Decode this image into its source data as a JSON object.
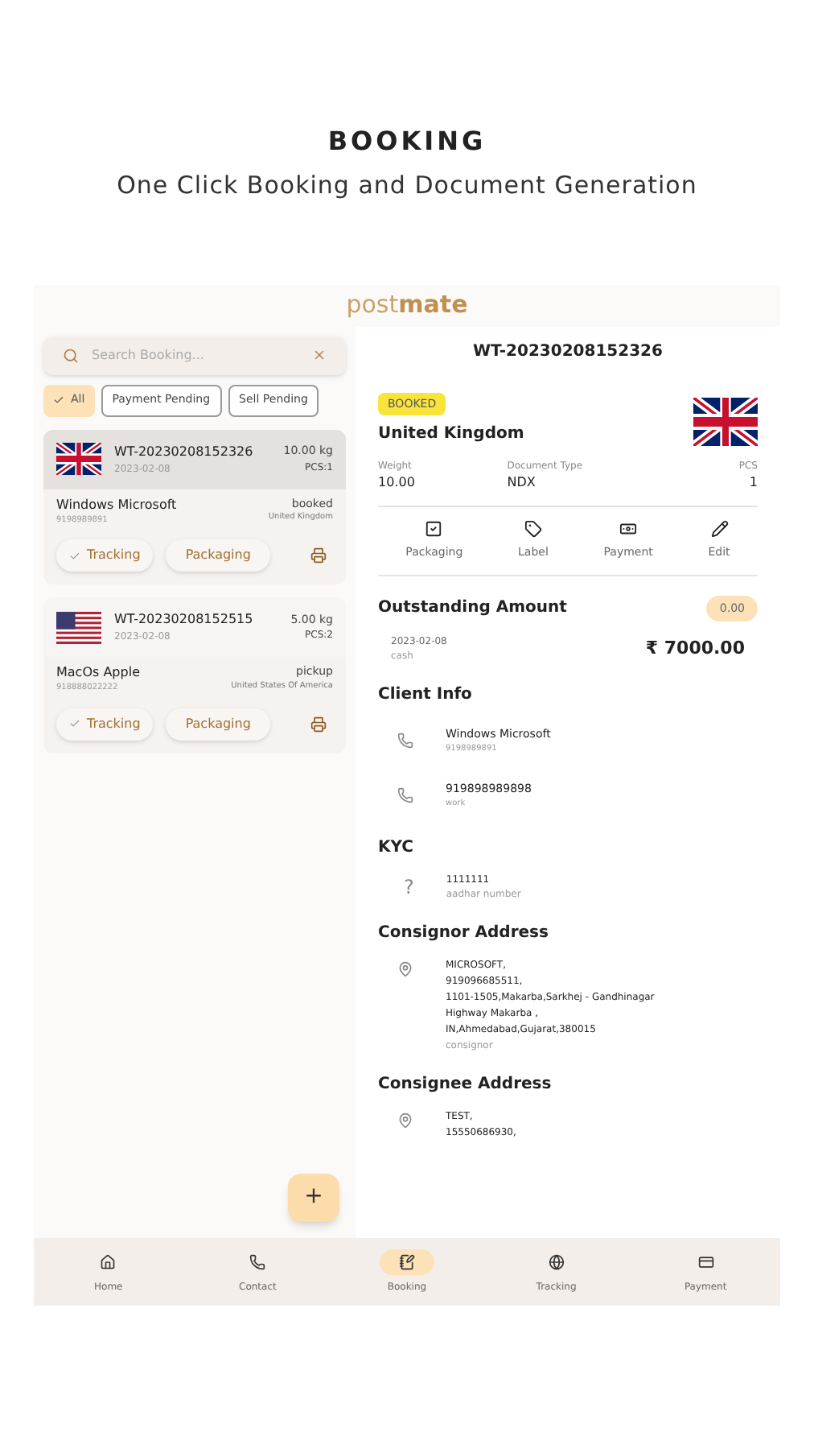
{
  "promo": {
    "title": "BOOKING",
    "subtitle": "One Click Booking and Document Generation"
  },
  "logo": {
    "light": "post",
    "bold": "mate"
  },
  "search": {
    "placeholder": "Search Booking..."
  },
  "filters": [
    {
      "label": "All",
      "selected": true
    },
    {
      "label": "Payment Pending",
      "selected": false
    },
    {
      "label": "Sell Pending",
      "selected": false
    }
  ],
  "bookings": [
    {
      "id": "WT-20230208152326",
      "date": "2023-02-08",
      "weight": "10.00 kg",
      "pcs": "PCS:1",
      "name": "Windows Microsoft",
      "phone": "9198989891",
      "status": "booked",
      "country": "United Kingdom",
      "flag": {
        "kind": "gb"
      },
      "selected": true,
      "tracking": "Tracking",
      "packaging": "Packaging"
    },
    {
      "id": "WT-20230208152515",
      "date": "2023-02-08",
      "weight": "5.00 kg",
      "pcs": "PCS:2",
      "name": "MacOs Apple",
      "phone": "918888022222",
      "status": "pickup",
      "country": "United States Of America",
      "flag": {
        "kind": "us"
      },
      "selected": false,
      "tracking": "Tracking",
      "packaging": "Packaging"
    }
  ],
  "fab": "+",
  "detail": {
    "id": "WT-20230208152326",
    "status": "BOOKED",
    "country": "United Kingdom",
    "flag": {
      "kind": "gb"
    },
    "fields": [
      {
        "label": "Weight",
        "value": "10.00"
      },
      {
        "label": "Document Type",
        "value": "NDX"
      },
      {
        "label": "PCS",
        "value": "1"
      }
    ],
    "actions": [
      {
        "kind": "packaging",
        "label": "Packaging"
      },
      {
        "kind": "label",
        "label": "Label"
      },
      {
        "kind": "payment",
        "label": "Payment"
      },
      {
        "kind": "edit",
        "label": "Edit"
      }
    ],
    "outstanding": {
      "title": "Outstanding Amount",
      "badge": "0.00",
      "date": "2023-02-08",
      "method": "cash",
      "amount": "₹ 7000.00"
    },
    "client_info": {
      "title": "Client Info",
      "entries": [
        {
          "primary": "Windows Microsoft",
          "secondary": "9198989891"
        },
        {
          "primary": "919898989898",
          "secondary": "work"
        }
      ]
    },
    "kyc": {
      "title": "KYC",
      "icon": "?",
      "primary": "1111111",
      "secondary": "aadhar number"
    },
    "consignor": {
      "title": "Consignor Address",
      "lines": [
        "MICROSOFT,",
        "919096685511,",
        "1101-1505,Makarba,Sarkhej - Gandhinagar",
        "Highway Makarba ,",
        "IN,Ahmedabad,Gujarat,380015"
      ],
      "note": "consignor"
    },
    "consignee": {
      "title": "Consignee Address",
      "lines": [
        "TEST,",
        "15550686930,"
      ]
    }
  },
  "nav": [
    {
      "kind": "home",
      "label": "Home",
      "selected": false
    },
    {
      "kind": "contact",
      "label": "Contact",
      "selected": false
    },
    {
      "kind": "booking",
      "label": "Booking",
      "selected": true
    },
    {
      "kind": "tracking",
      "label": "Tracking",
      "selected": false
    },
    {
      "kind": "payment",
      "label": "Payment",
      "selected": false
    }
  ]
}
